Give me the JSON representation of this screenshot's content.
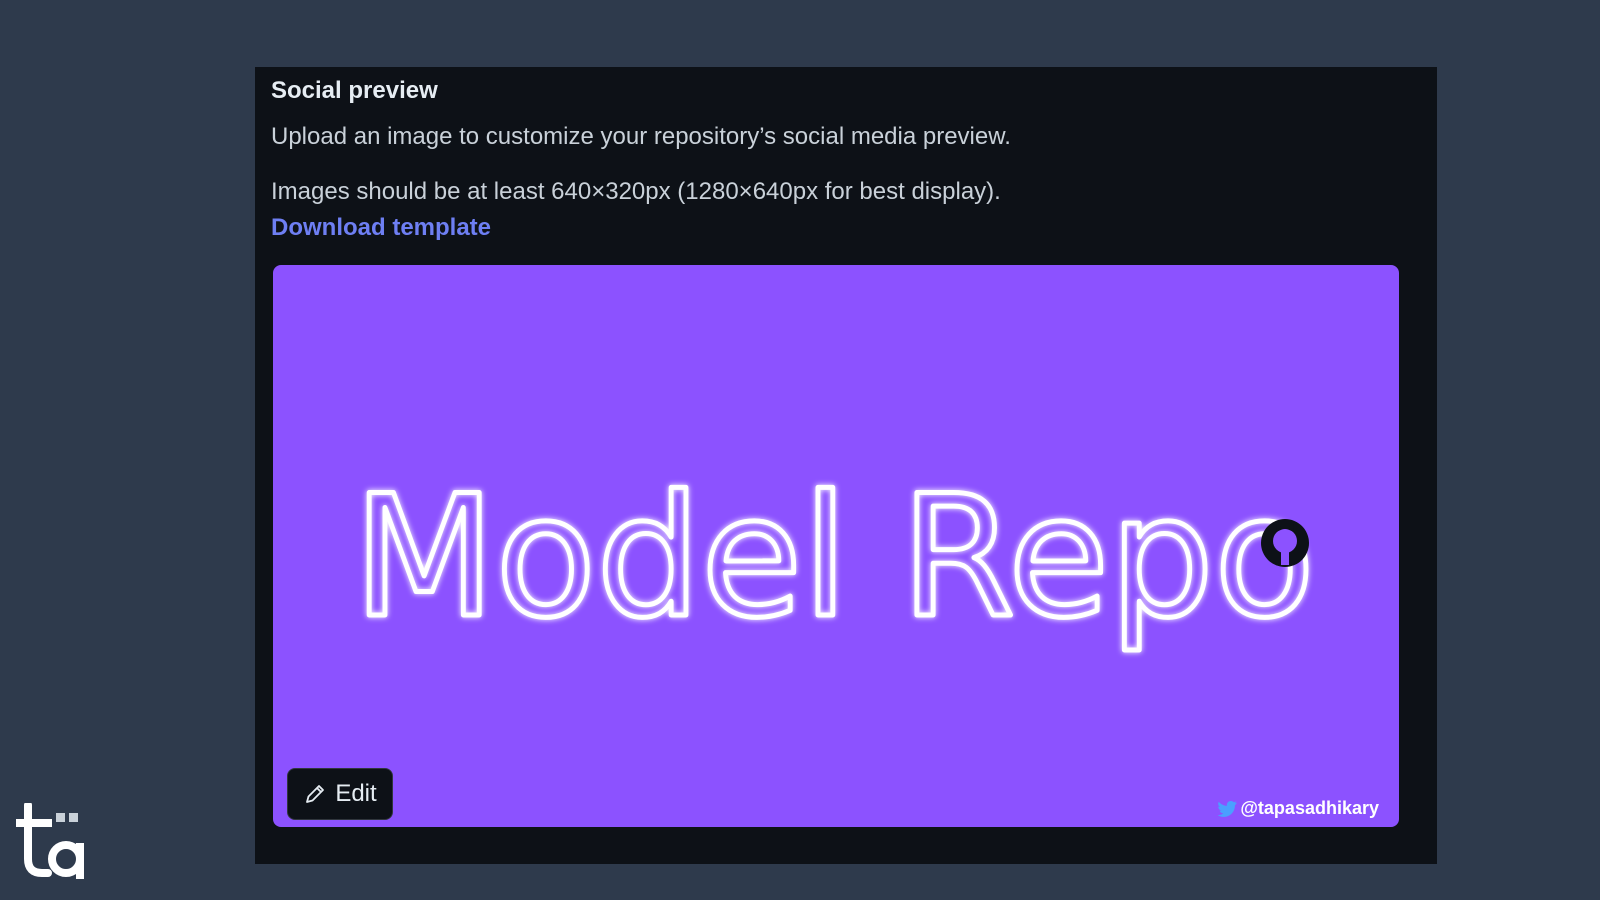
{
  "section": {
    "title": "Social preview",
    "description": "Upload an image to customize your repository’s social media preview.",
    "requirements": "Images should be at least 640×320px (1280×640px for best display).",
    "download_link": "Download template"
  },
  "preview_image": {
    "headline": "Model Repo",
    "handle": "@tapasadhikary",
    "background_color": "#8c52ff",
    "icons": [
      "github-icon",
      "twitter-icon"
    ]
  },
  "edit_button": {
    "label": "Edit",
    "icon": "pencil-icon"
  },
  "watermark": {
    "text": "ta"
  },
  "colors": {
    "page_background": "#2e3a4c",
    "panel_background": "#0d1117",
    "link": "#6e7ff3"
  }
}
